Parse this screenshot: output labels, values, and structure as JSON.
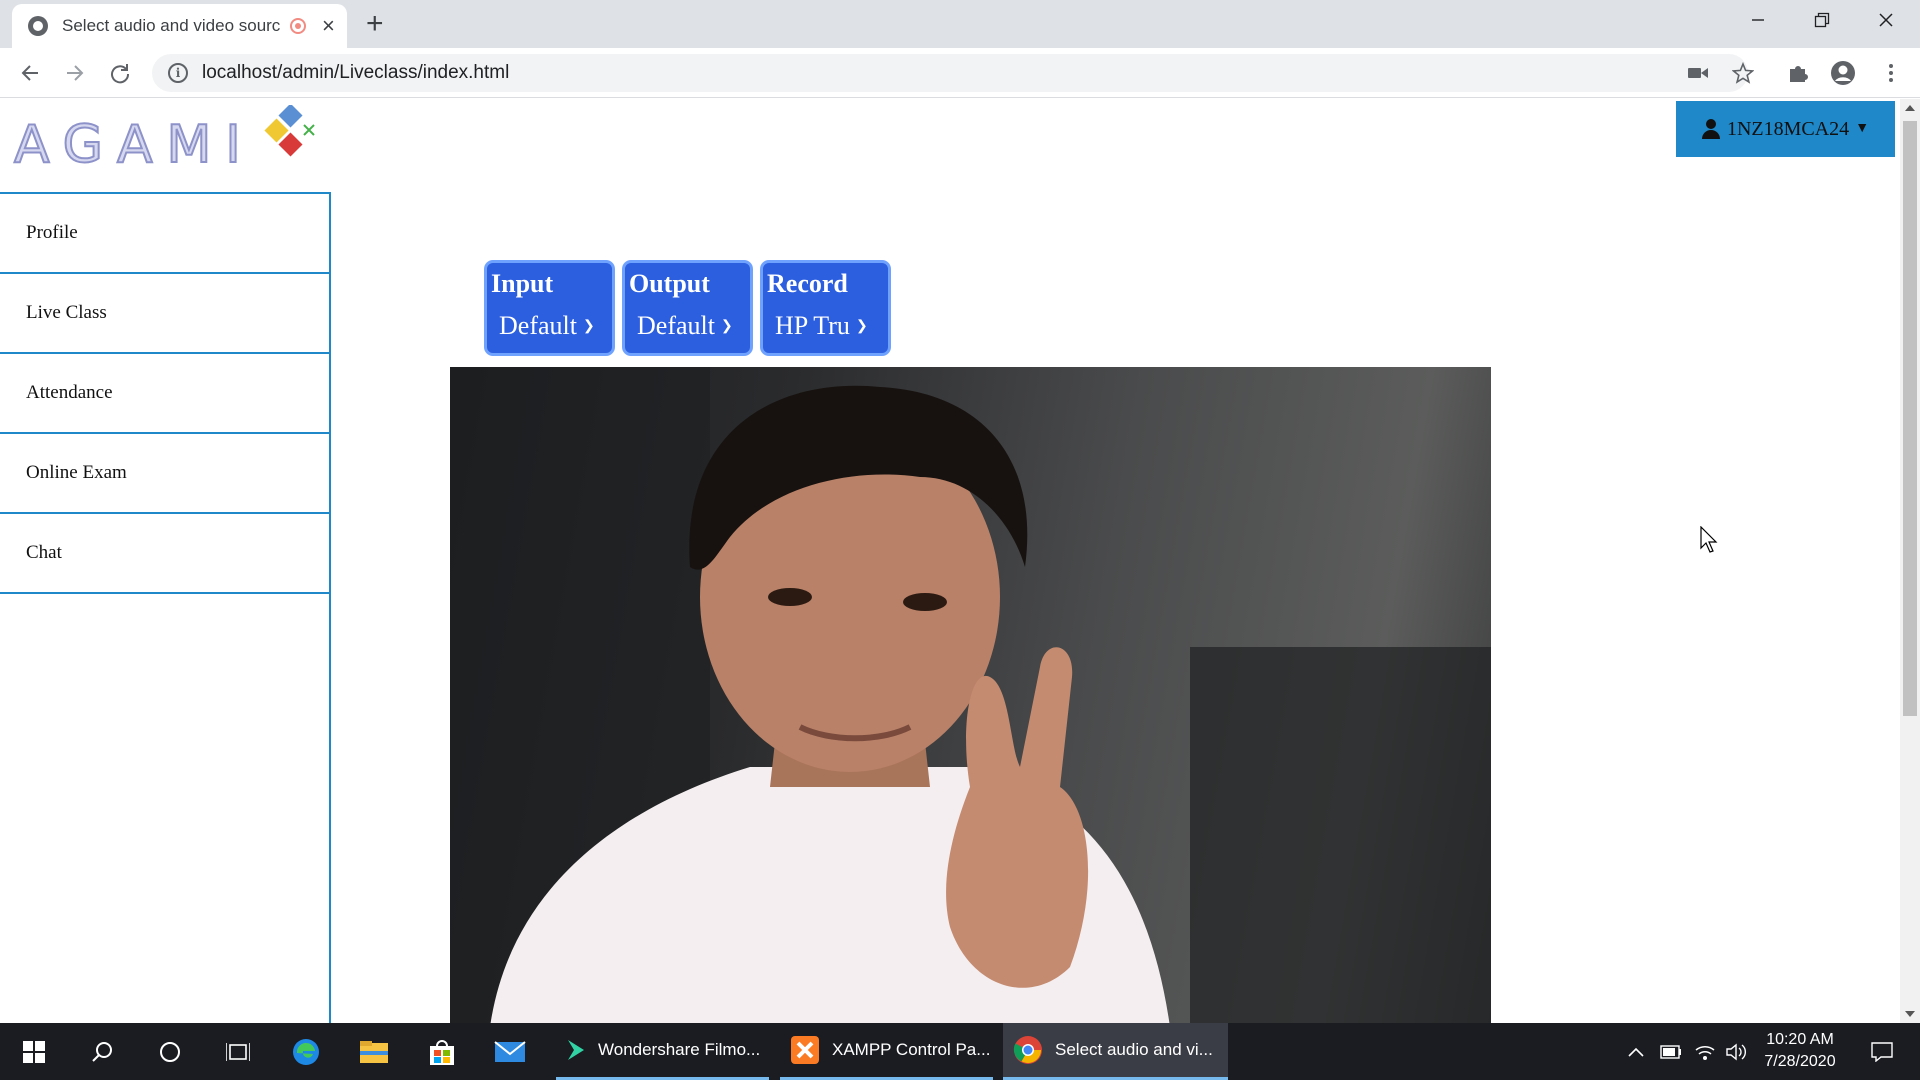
{
  "browser": {
    "tab_title": "Select audio and video sourc",
    "url": "localhost/admin/Liveclass/index.html"
  },
  "logo": {
    "text": "AGAMI"
  },
  "user_menu": {
    "label": "1NZ18MCA24"
  },
  "sidebar": {
    "items": [
      {
        "label": "Profile"
      },
      {
        "label": "Live Class"
      },
      {
        "label": "Attendance"
      },
      {
        "label": "Online Exam"
      },
      {
        "label": "Chat"
      }
    ]
  },
  "controls": [
    {
      "label": "Input",
      "value": "Default"
    },
    {
      "label": "Output",
      "value": "Default"
    },
    {
      "label": "Record",
      "value": "HP Tru"
    }
  ],
  "taskbar": {
    "apps": [
      {
        "label": "Wondershare Filmo..."
      },
      {
        "label": "XAMPP Control Pa..."
      },
      {
        "label": "Select audio and vi..."
      }
    ],
    "time": "10:20 AM",
    "date": "7/28/2020"
  },
  "colors": {
    "accent_blue": "#1f88c9",
    "control_blue": "#2b5fe0"
  }
}
